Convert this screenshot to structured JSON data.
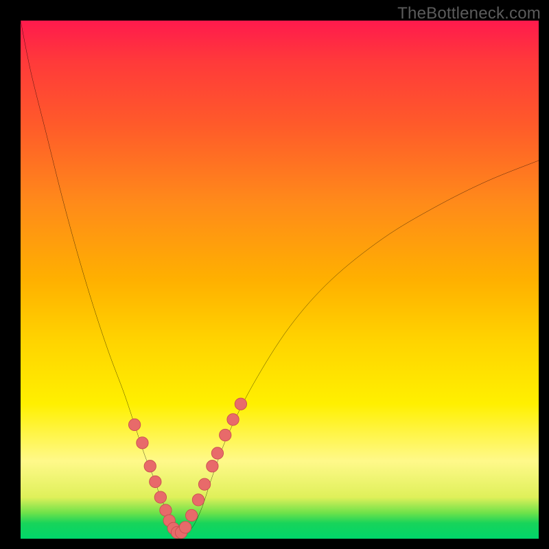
{
  "watermark": "TheBottleneck.com",
  "colors": {
    "frame": "#000000",
    "curve_stroke": "#000000",
    "dot_fill": "#e86a6a",
    "dot_stroke": "#c94f4f"
  },
  "chart_data": {
    "type": "line",
    "title": "",
    "xlabel": "",
    "ylabel": "",
    "xlim": [
      0,
      100
    ],
    "ylim": [
      0,
      100
    ],
    "x": [
      0,
      2,
      5,
      8,
      11,
      14,
      17,
      20,
      22,
      24,
      26,
      27,
      29,
      30,
      31,
      33,
      35,
      37,
      40,
      45,
      52,
      60,
      70,
      80,
      90,
      100
    ],
    "values": [
      100,
      90,
      78,
      66,
      55,
      45,
      36,
      28,
      22,
      16,
      11,
      8,
      4,
      2,
      1,
      2,
      6,
      12,
      20,
      30,
      41,
      50,
      58,
      64,
      69,
      73
    ],
    "dots_x": [
      22,
      23.5,
      25,
      26,
      27,
      28,
      28.7,
      29.5,
      30.2,
      31,
      31.8,
      33,
      34.3,
      35.5,
      37,
      38,
      39.5,
      41,
      42.5
    ],
    "dots_y": [
      22,
      18.5,
      14,
      11,
      8,
      5.5,
      3.5,
      2,
      1.2,
      1.2,
      2.2,
      4.5,
      7.5,
      10.5,
      14,
      16.5,
      20,
      23,
      26
    ],
    "annotation": "V-shaped bottleneck curve over rainbow heat background; pink dots cluster near the trough."
  }
}
